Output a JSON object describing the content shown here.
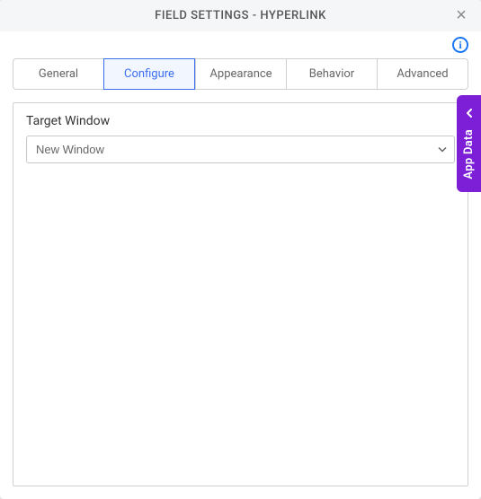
{
  "header": {
    "title": "FIELD SETTINGS - HYPERLINK"
  },
  "tabs": [
    {
      "label": "General"
    },
    {
      "label": "Configure"
    },
    {
      "label": "Appearance"
    },
    {
      "label": "Behavior"
    },
    {
      "label": "Advanced"
    }
  ],
  "activeTabIndex": 1,
  "configure": {
    "targetWindow": {
      "label": "Target Window",
      "value": "New Window"
    }
  },
  "sideTab": {
    "label": "App Data"
  },
  "colors": {
    "accent": "#3b6ef2",
    "sideTab": "#7c1fd6"
  }
}
